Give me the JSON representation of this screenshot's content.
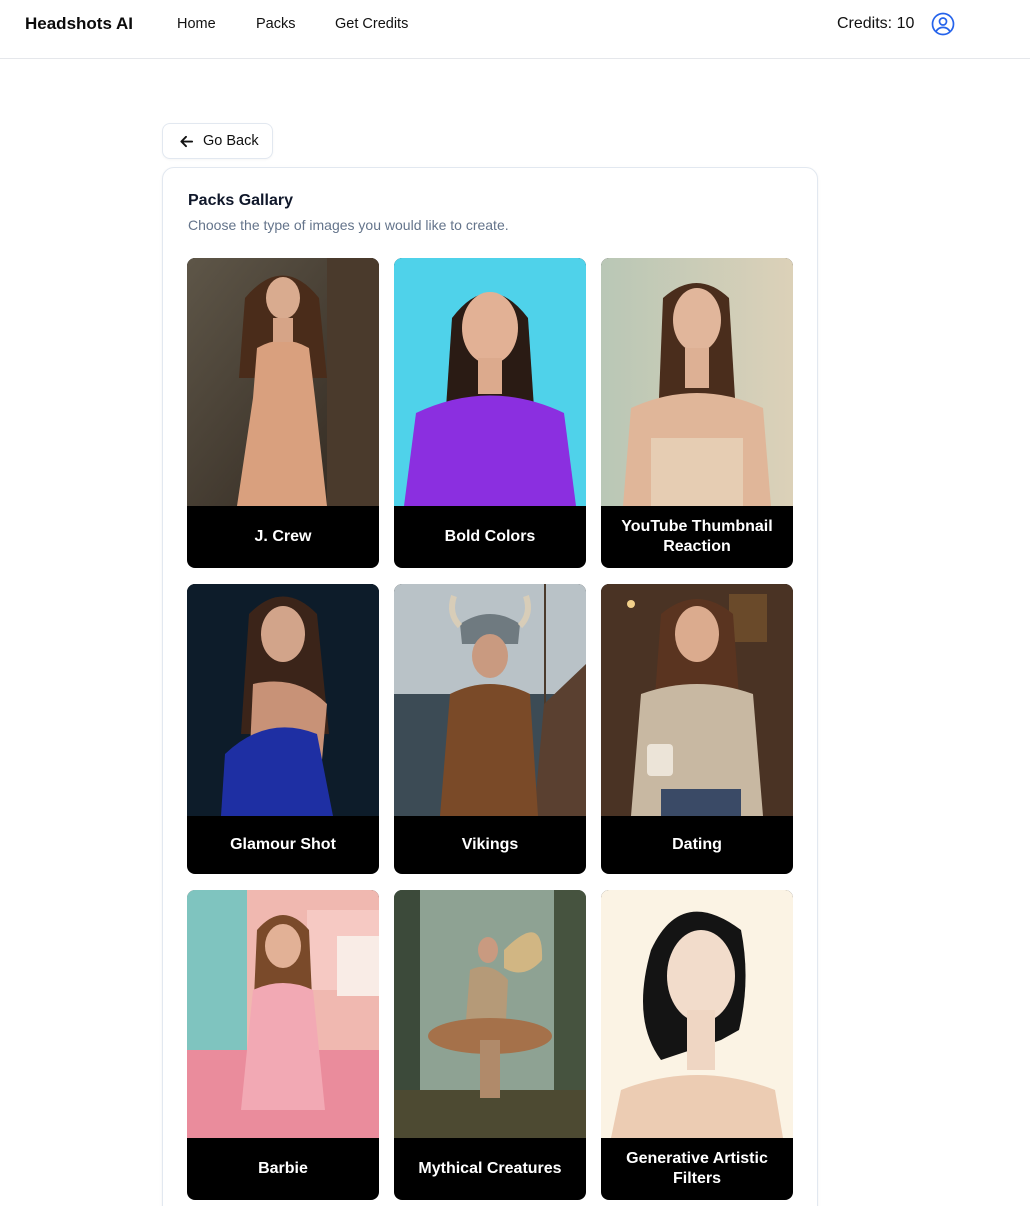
{
  "nav": {
    "brand": "Headshots AI",
    "links": [
      "Home",
      "Packs",
      "Get Credits"
    ],
    "credits": "Credits: 10",
    "accent": "#2563eb"
  },
  "go_back": {
    "label": "Go Back"
  },
  "gallery": {
    "title": "Packs Gallary",
    "subtitle": "Choose the type of images you would like to create.",
    "packs": [
      {
        "label": "J. Crew"
      },
      {
        "label": "Bold Colors"
      },
      {
        "label": "YouTube Thumbnail Reaction"
      },
      {
        "label": "Glamour Shot"
      },
      {
        "label": "Vikings"
      },
      {
        "label": "Dating"
      },
      {
        "label": "Barbie"
      },
      {
        "label": "Mythical Creatures"
      },
      {
        "label": "Generative Artistic Filters"
      }
    ]
  }
}
